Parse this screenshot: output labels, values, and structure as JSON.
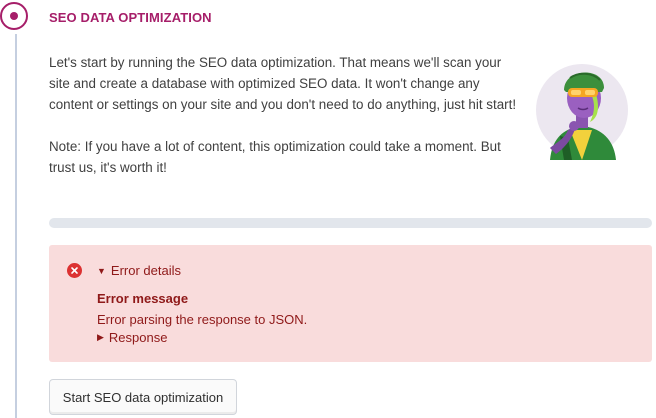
{
  "step": {
    "title": "SEO DATA OPTIMIZATION",
    "paragraphs": [
      "Let's start by running the SEO data optimization. That means we'll scan your site and create a database with optimized SEO data. It won't change any content or settings on your site and you don't need to do anything, just hit start!",
      "Note: If you have a lot of content, this optimization could take a moment. But trust us, it's worth it!"
    ]
  },
  "progress": {
    "value_percent": 0
  },
  "error": {
    "summary_label": "Error details",
    "heading": "Error message",
    "message": "Error parsing the response to JSON.",
    "response_label": "Response"
  },
  "actions": {
    "start_label": "Start SEO data optimization"
  },
  "colors": {
    "accent": "#a61e69",
    "error_bg": "#f9dcdc",
    "error_text": "#8f1919",
    "error_icon": "#dc3232",
    "track": "#e2e6ec"
  },
  "icons": {
    "step": "active-step-icon",
    "error": "error-x-icon",
    "expanded": "triangle-down-icon",
    "collapsed": "triangle-right-icon"
  }
}
